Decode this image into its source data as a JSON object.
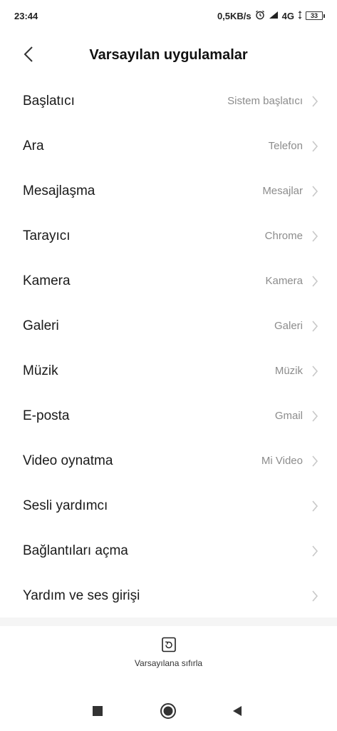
{
  "status_bar": {
    "time": "23:44",
    "net_speed": "0,5KB/s",
    "network": "4G",
    "battery": "33"
  },
  "header": {
    "title": "Varsayılan uygulamalar"
  },
  "items": [
    {
      "label": "Başlatıcı",
      "value": "Sistem başlatıcı"
    },
    {
      "label": "Ara",
      "value": "Telefon"
    },
    {
      "label": "Mesajlaşma",
      "value": "Mesajlar"
    },
    {
      "label": "Tarayıcı",
      "value": "Chrome"
    },
    {
      "label": "Kamera",
      "value": "Kamera"
    },
    {
      "label": "Galeri",
      "value": "Galeri"
    },
    {
      "label": "Müzik",
      "value": "Müzik"
    },
    {
      "label": "E-posta",
      "value": "Gmail"
    },
    {
      "label": "Video oynatma",
      "value": "Mi Video"
    },
    {
      "label": "Sesli yardımcı",
      "value": ""
    },
    {
      "label": "Bağlantıları açma",
      "value": ""
    },
    {
      "label": "Yardım ve ses girişi",
      "value": ""
    }
  ],
  "reset": {
    "label": "Varsayılana sıfırla",
    "icon": "reset-icon"
  },
  "nav": {
    "icons": [
      "recents-square-icon",
      "home-circle-icon",
      "back-triangle-icon"
    ]
  }
}
